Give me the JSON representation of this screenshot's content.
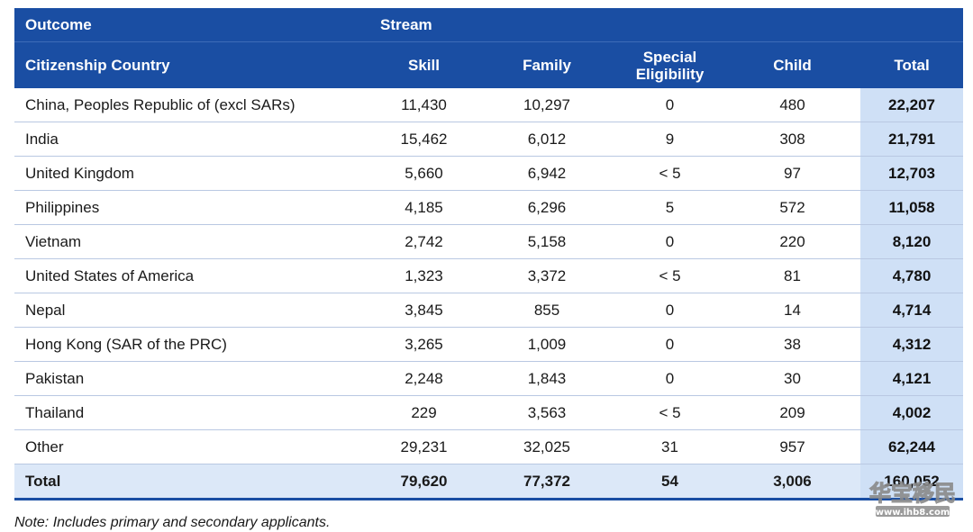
{
  "table": {
    "header_top": {
      "outcome": "Outcome",
      "stream": "Stream"
    },
    "header_columns": {
      "country": "Citizenship Country",
      "skill": "Skill",
      "family": "Family",
      "special_line1": "Special",
      "special_line2": "Eligibility",
      "child": "Child",
      "total": "Total"
    },
    "rows": [
      {
        "country": "China, Peoples Republic of (excl SARs)",
        "skill": "11,430",
        "family": "10,297",
        "special": "0",
        "child": "480",
        "total": "22,207"
      },
      {
        "country": "India",
        "skill": "15,462",
        "family": "6,012",
        "special": "9",
        "child": "308",
        "total": "21,791"
      },
      {
        "country": "United Kingdom",
        "skill": "5,660",
        "family": "6,942",
        "special": "< 5",
        "child": "97",
        "total": "12,703"
      },
      {
        "country": "Philippines",
        "skill": "4,185",
        "family": "6,296",
        "special": "5",
        "child": "572",
        "total": "11,058"
      },
      {
        "country": "Vietnam",
        "skill": "2,742",
        "family": "5,158",
        "special": "0",
        "child": "220",
        "total": "8,120"
      },
      {
        "country": "United States of America",
        "skill": "1,323",
        "family": "3,372",
        "special": "< 5",
        "child": "81",
        "total": "4,780"
      },
      {
        "country": "Nepal",
        "skill": "3,845",
        "family": "855",
        "special": "0",
        "child": "14",
        "total": "4,714"
      },
      {
        "country": "Hong Kong (SAR of the PRC)",
        "skill": "3,265",
        "family": "1,009",
        "special": "0",
        "child": "38",
        "total": "4,312"
      },
      {
        "country": "Pakistan",
        "skill": "2,248",
        "family": "1,843",
        "special": "0",
        "child": "30",
        "total": "4,121"
      },
      {
        "country": "Thailand",
        "skill": "229",
        "family": "3,563",
        "special": "< 5",
        "child": "209",
        "total": "4,002"
      },
      {
        "country": "Other",
        "skill": "29,231",
        "family": "32,025",
        "special": "31",
        "child": "957",
        "total": "62,244"
      }
    ],
    "total_row": {
      "country": "Total",
      "skill": "79,620",
      "family": "77,372",
      "special": "54",
      "child": "3,006",
      "total": "160,052"
    }
  },
  "note": "Note: Includes primary and secondary applicants.",
  "watermark": {
    "title": "华宝移民",
    "url": "www.ihb8.com"
  },
  "colors": {
    "header_bg": "#1a4ea3",
    "total_col_bg": "#cfe0f6",
    "row_border": "#b9c8e2"
  }
}
